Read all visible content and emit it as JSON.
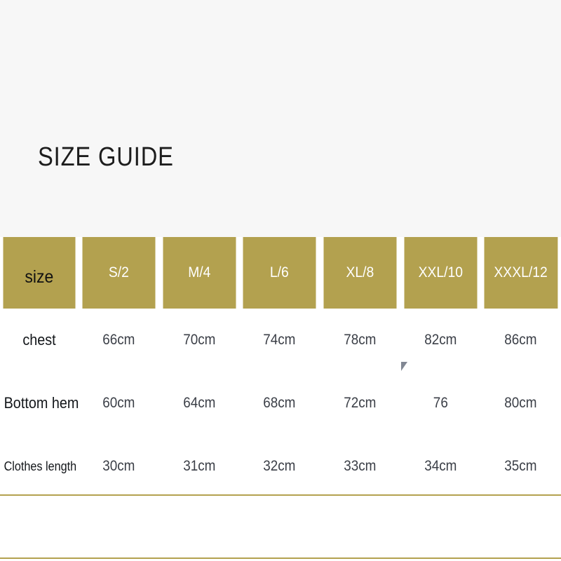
{
  "page": {
    "title": "SIZE GUIDE",
    "background_color": "#f7f7f7",
    "accent_color": "#b3a14f"
  },
  "table": {
    "corner_label": "size",
    "columns": [
      "S/2",
      "M/4",
      "L/6",
      "XL/8",
      "XXL/10",
      "XXXL/12"
    ],
    "rows": [
      {
        "label": "chest",
        "values": [
          "66cm",
          "70cm",
          "74cm",
          "78cm",
          "82cm",
          "86cm"
        ]
      },
      {
        "label": "Bottom hem",
        "values": [
          "60cm",
          "64cm",
          "68cm",
          "72cm",
          "76",
          "80cm"
        ]
      },
      {
        "label": "Clothes length",
        "values": [
          "30cm",
          "31cm",
          "32cm",
          "33cm",
          "34cm",
          "35cm"
        ]
      }
    ]
  }
}
